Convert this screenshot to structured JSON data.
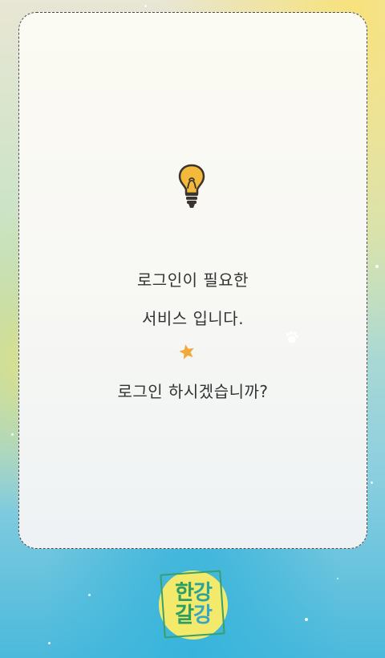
{
  "dialog": {
    "line1": "로그인이 필요한",
    "line2": "서비스 입니다.",
    "line3": "로그인 하시겠습니까?"
  },
  "logo": {
    "char1": "한",
    "char2": "강",
    "char3": "갈",
    "char4": "강"
  },
  "icons": {
    "bulb": "lightbulb-icon",
    "star": "star-icon",
    "paw": "paw-print-icon"
  },
  "colors": {
    "card_border": "#4a4a4a",
    "text": "#333333",
    "bulb_glow": "#f2b93a",
    "star": "#f2a93b",
    "logo_bg": "#f3e96a",
    "logo_green": "#2e9d62",
    "logo_blue": "#39a6c9"
  }
}
